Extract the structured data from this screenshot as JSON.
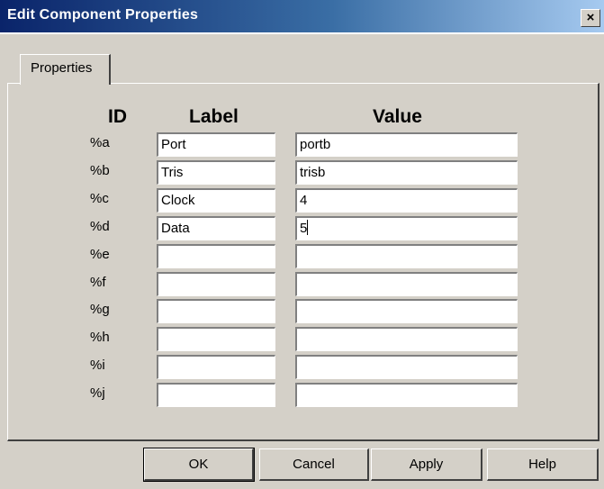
{
  "window": {
    "title": "Edit Component Properties",
    "close_glyph": "×"
  },
  "tabs": [
    {
      "label": "Properties",
      "selected": true
    }
  ],
  "columns": {
    "id": "ID",
    "label": "Label",
    "value": "Value"
  },
  "rows": [
    {
      "id": "%a",
      "label": "Port",
      "value": "portb"
    },
    {
      "id": "%b",
      "label": "Tris",
      "value": "trisb"
    },
    {
      "id": "%c",
      "label": "Clock",
      "value": "4"
    },
    {
      "id": "%d",
      "label": "Data",
      "value": "5"
    },
    {
      "id": "%e",
      "label": "",
      "value": ""
    },
    {
      "id": "%f",
      "label": "",
      "value": ""
    },
    {
      "id": "%g",
      "label": "",
      "value": ""
    },
    {
      "id": "%h",
      "label": "",
      "value": ""
    },
    {
      "id": "%i",
      "label": "",
      "value": ""
    },
    {
      "id": "%j",
      "label": "",
      "value": ""
    }
  ],
  "focused_row": 3,
  "buttons": {
    "ok": "OK",
    "cancel": "Cancel",
    "apply": "Apply",
    "help": "Help"
  },
  "colors": {
    "title_start": "#0a246a",
    "title_end": "#a6caf0",
    "face": "#d4d0c8"
  }
}
